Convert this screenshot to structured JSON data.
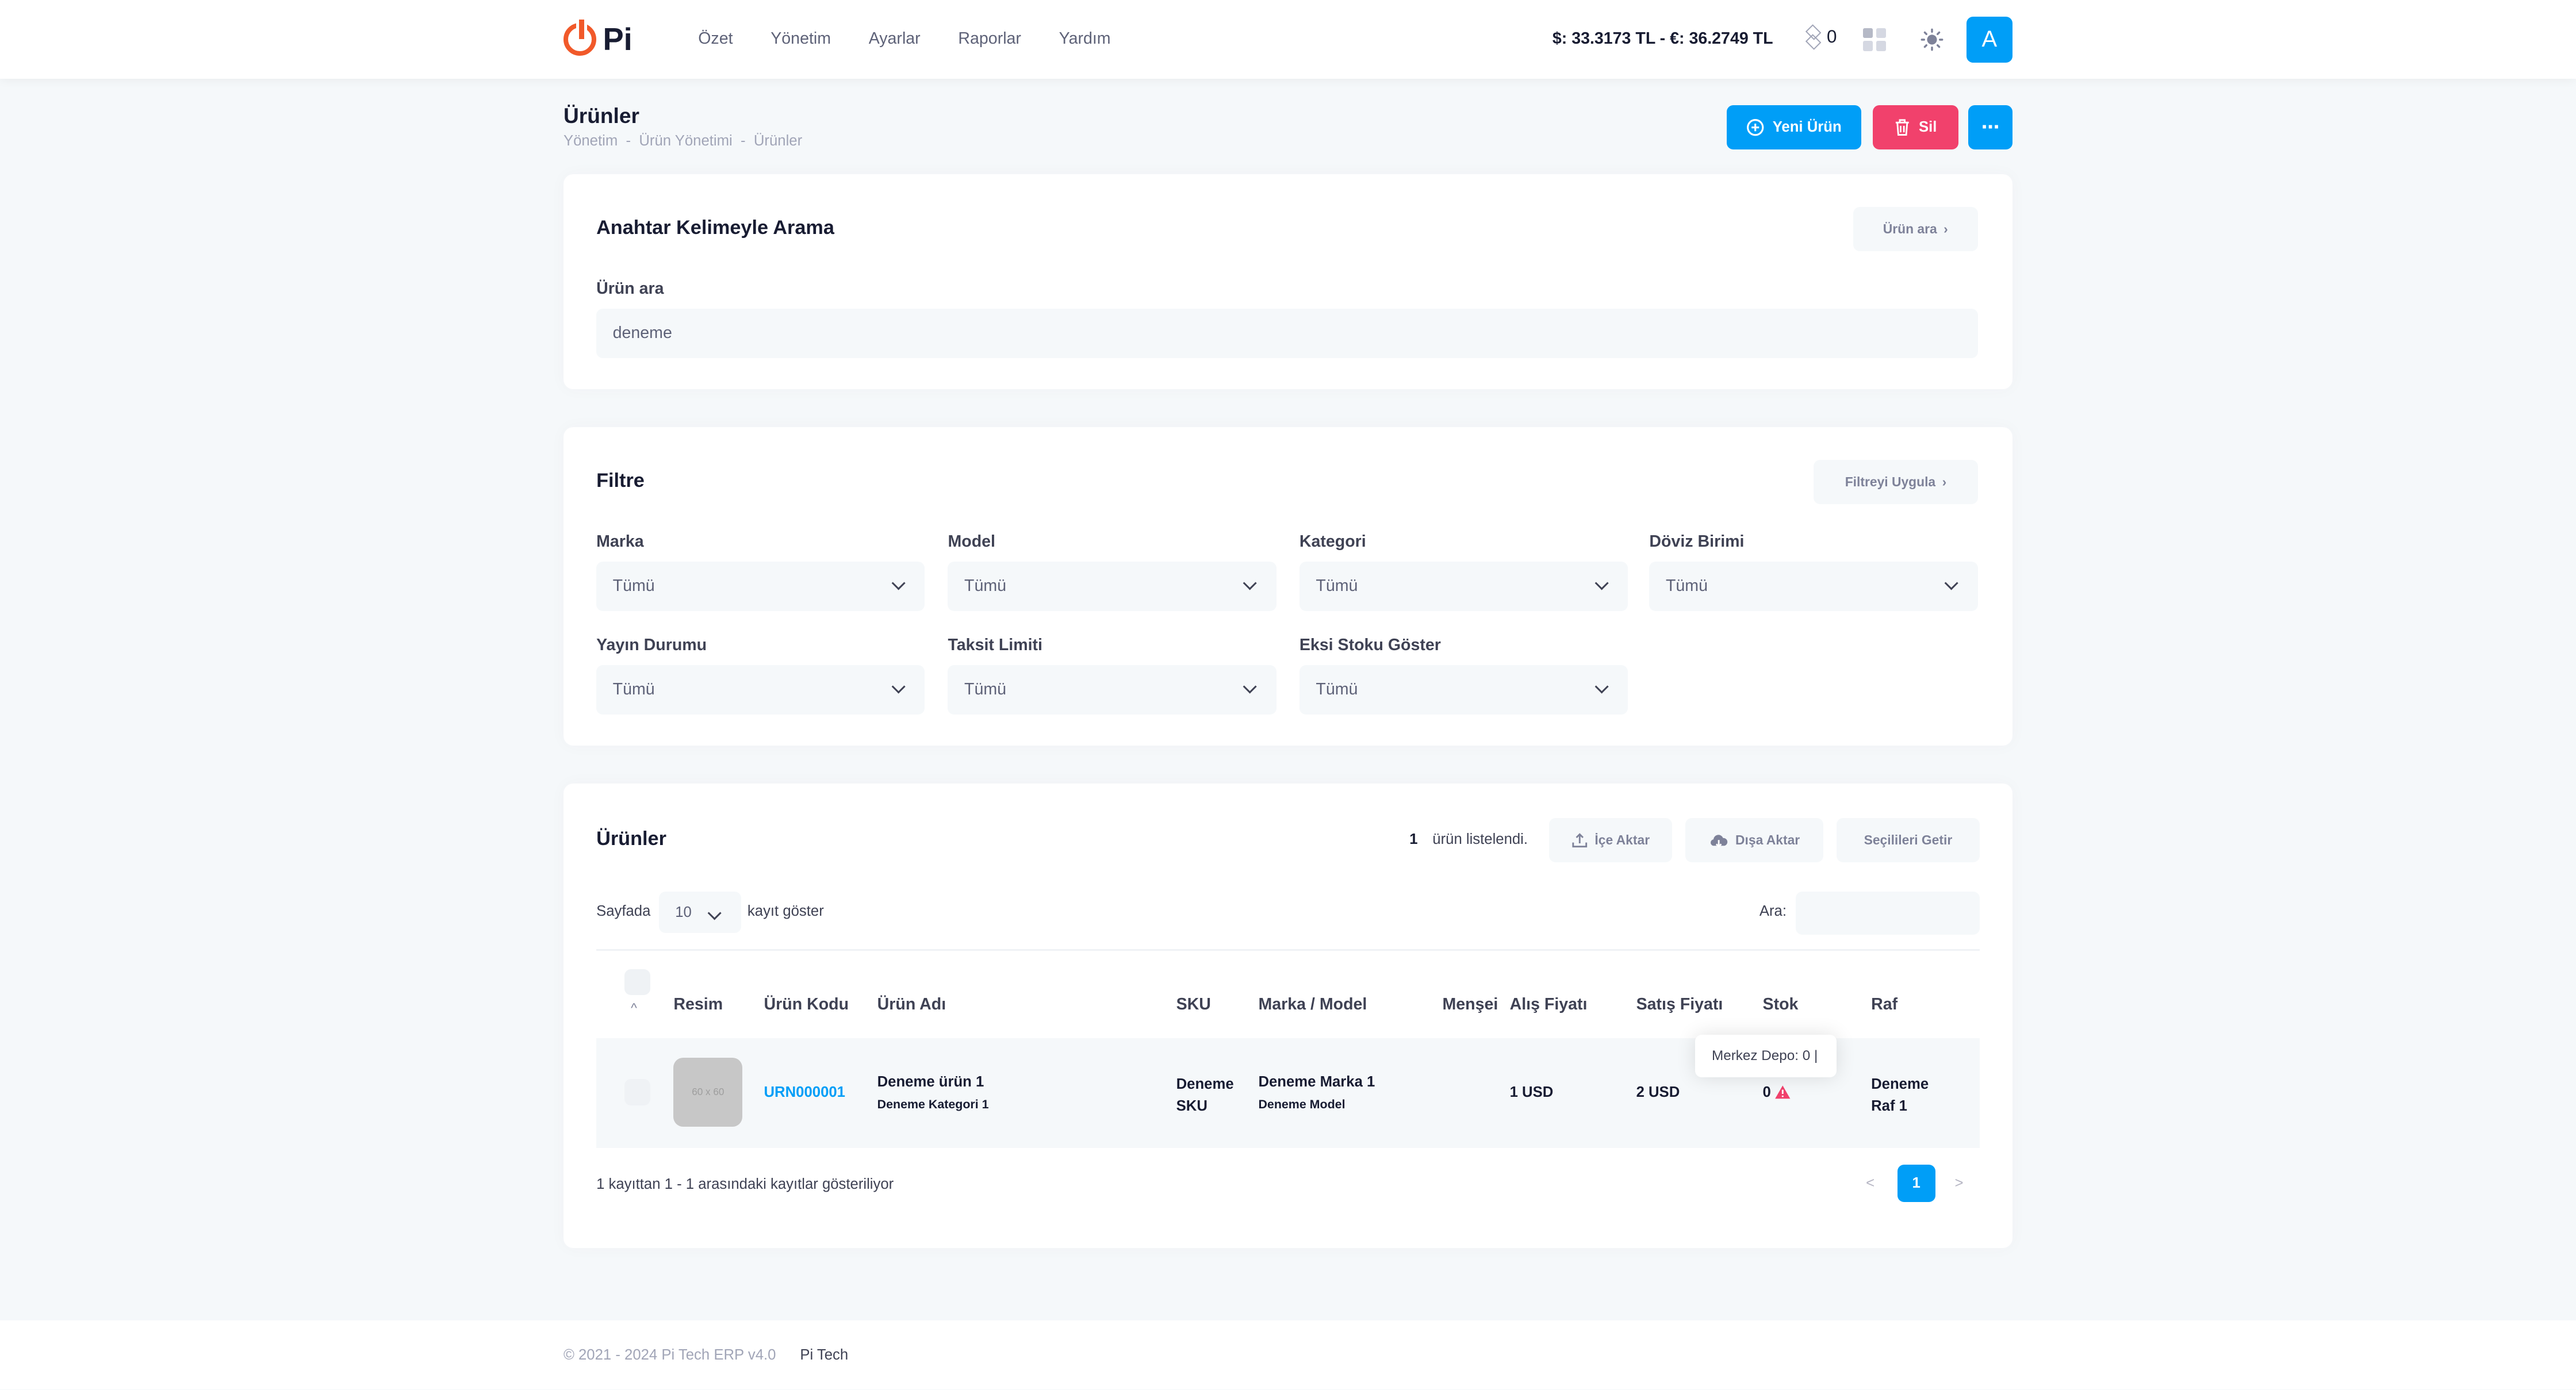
{
  "app": {
    "logo_text": "Pi"
  },
  "nav": {
    "items": [
      "Özet",
      "Yönetim",
      "Ayarlar",
      "Raporlar",
      "Yardım"
    ]
  },
  "header": {
    "currency": "$: 33.3173 TL - €: 36.2749 TL",
    "coin_count": "0",
    "avatar_letter": "A",
    "accent": "#009ef7"
  },
  "page": {
    "title": "Ürünler",
    "breadcrumb": [
      "Yönetim",
      "Ürün Yönetimi",
      "Ürünler"
    ],
    "new_button": "Yeni Ürün",
    "delete_button": "Sil",
    "more_button": "···",
    "danger": "#f1416c"
  },
  "search": {
    "title": "Anahtar Kelimeyle Arama",
    "button": "Ürün ara",
    "label": "Ürün ara",
    "value": "deneme"
  },
  "filter": {
    "title": "Filtre",
    "button": "Filtreyi Uygula",
    "fields": [
      {
        "label": "Marka",
        "value": "Tümü"
      },
      {
        "label": "Model",
        "value": "Tümü"
      },
      {
        "label": "Kategori",
        "value": "Tümü"
      },
      {
        "label": "Döviz Birimi",
        "value": "Tümü"
      },
      {
        "label": "Yayın Durumu",
        "value": "Tümü"
      },
      {
        "label": "Taksit Limiti",
        "value": "Tümü"
      },
      {
        "label": "Eksi Stoku Göster",
        "value": "Tümü"
      }
    ]
  },
  "products": {
    "title": "Ürünler",
    "count": "1",
    "count_text": "ürün listelendi.",
    "import_button": "İçe Aktar",
    "export_button": "Dışa Aktar",
    "selected_button": "Seçilileri Getir",
    "per_page_prefix": "Sayfada",
    "per_page_value": "10",
    "per_page_suffix": "kayıt göster",
    "search_label": "Ara:",
    "search_value": "",
    "columns": [
      "Resim",
      "Ürün Kodu",
      "Ürün Adı",
      "SKU",
      "Marka / Model",
      "Menşei",
      "Alış Fiyatı",
      "Satış Fiyatı",
      "Stok",
      "Raf"
    ],
    "row": {
      "image_text": "60 x 60",
      "code": "URN000001",
      "name": "Deneme ürün 1",
      "category": "Deneme Kategori 1",
      "sku_line1": "Deneme",
      "sku_line2": "SKU",
      "brand": "Deneme Marka 1",
      "model": "Deneme Model",
      "origin": "",
      "buy_price": "1 USD",
      "sell_price": "2 USD",
      "stock": "0",
      "shelf_line1": "Deneme",
      "shelf_line2": "Raf 1"
    },
    "tooltip": "Merkez Depo: 0 |",
    "info": "1 kayıttan 1 - 1 arasındaki kayıtlar gösteriliyor",
    "pagination": {
      "prev": "<",
      "current": "1",
      "next": ">"
    }
  },
  "footer": {
    "copyright": "© 2021 - 2024 Pi Tech ERP v4.0",
    "company": "Pi Tech"
  }
}
